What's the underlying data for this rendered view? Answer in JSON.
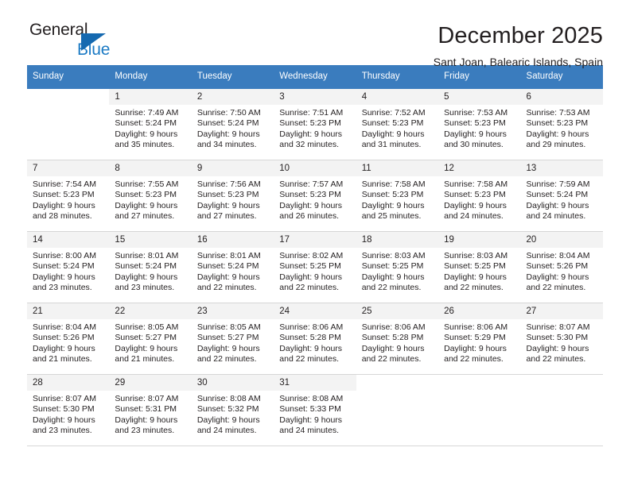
{
  "brand": {
    "line1": "General",
    "line2": "Blue",
    "triangle_color": "#1569b0",
    "blue_text_color": "#1b7ac4"
  },
  "header": {
    "title": "December 2025",
    "subtitle": "Sant Joan, Balearic Islands, Spain"
  },
  "theme": {
    "header_row_bg": "#3a7cbe",
    "header_row_text": "#ffffff",
    "daynum_bg": "#f3f3f3",
    "grid_line": "#d6d6d6"
  },
  "weekdays": [
    "Sunday",
    "Monday",
    "Tuesday",
    "Wednesday",
    "Thursday",
    "Friday",
    "Saturday"
  ],
  "weeks": [
    [
      {
        "day": "",
        "lines": []
      },
      {
        "day": "1",
        "lines": [
          "Sunrise: 7:49 AM",
          "Sunset: 5:24 PM",
          "Daylight: 9 hours",
          "and 35 minutes."
        ]
      },
      {
        "day": "2",
        "lines": [
          "Sunrise: 7:50 AM",
          "Sunset: 5:24 PM",
          "Daylight: 9 hours",
          "and 34 minutes."
        ]
      },
      {
        "day": "3",
        "lines": [
          "Sunrise: 7:51 AM",
          "Sunset: 5:23 PM",
          "Daylight: 9 hours",
          "and 32 minutes."
        ]
      },
      {
        "day": "4",
        "lines": [
          "Sunrise: 7:52 AM",
          "Sunset: 5:23 PM",
          "Daylight: 9 hours",
          "and 31 minutes."
        ]
      },
      {
        "day": "5",
        "lines": [
          "Sunrise: 7:53 AM",
          "Sunset: 5:23 PM",
          "Daylight: 9 hours",
          "and 30 minutes."
        ]
      },
      {
        "day": "6",
        "lines": [
          "Sunrise: 7:53 AM",
          "Sunset: 5:23 PM",
          "Daylight: 9 hours",
          "and 29 minutes."
        ]
      }
    ],
    [
      {
        "day": "7",
        "lines": [
          "Sunrise: 7:54 AM",
          "Sunset: 5:23 PM",
          "Daylight: 9 hours",
          "and 28 minutes."
        ]
      },
      {
        "day": "8",
        "lines": [
          "Sunrise: 7:55 AM",
          "Sunset: 5:23 PM",
          "Daylight: 9 hours",
          "and 27 minutes."
        ]
      },
      {
        "day": "9",
        "lines": [
          "Sunrise: 7:56 AM",
          "Sunset: 5:23 PM",
          "Daylight: 9 hours",
          "and 27 minutes."
        ]
      },
      {
        "day": "10",
        "lines": [
          "Sunrise: 7:57 AM",
          "Sunset: 5:23 PM",
          "Daylight: 9 hours",
          "and 26 minutes."
        ]
      },
      {
        "day": "11",
        "lines": [
          "Sunrise: 7:58 AM",
          "Sunset: 5:23 PM",
          "Daylight: 9 hours",
          "and 25 minutes."
        ]
      },
      {
        "day": "12",
        "lines": [
          "Sunrise: 7:58 AM",
          "Sunset: 5:23 PM",
          "Daylight: 9 hours",
          "and 24 minutes."
        ]
      },
      {
        "day": "13",
        "lines": [
          "Sunrise: 7:59 AM",
          "Sunset: 5:24 PM",
          "Daylight: 9 hours",
          "and 24 minutes."
        ]
      }
    ],
    [
      {
        "day": "14",
        "lines": [
          "Sunrise: 8:00 AM",
          "Sunset: 5:24 PM",
          "Daylight: 9 hours",
          "and 23 minutes."
        ]
      },
      {
        "day": "15",
        "lines": [
          "Sunrise: 8:01 AM",
          "Sunset: 5:24 PM",
          "Daylight: 9 hours",
          "and 23 minutes."
        ]
      },
      {
        "day": "16",
        "lines": [
          "Sunrise: 8:01 AM",
          "Sunset: 5:24 PM",
          "Daylight: 9 hours",
          "and 22 minutes."
        ]
      },
      {
        "day": "17",
        "lines": [
          "Sunrise: 8:02 AM",
          "Sunset: 5:25 PM",
          "Daylight: 9 hours",
          "and 22 minutes."
        ]
      },
      {
        "day": "18",
        "lines": [
          "Sunrise: 8:03 AM",
          "Sunset: 5:25 PM",
          "Daylight: 9 hours",
          "and 22 minutes."
        ]
      },
      {
        "day": "19",
        "lines": [
          "Sunrise: 8:03 AM",
          "Sunset: 5:25 PM",
          "Daylight: 9 hours",
          "and 22 minutes."
        ]
      },
      {
        "day": "20",
        "lines": [
          "Sunrise: 8:04 AM",
          "Sunset: 5:26 PM",
          "Daylight: 9 hours",
          "and 22 minutes."
        ]
      }
    ],
    [
      {
        "day": "21",
        "lines": [
          "Sunrise: 8:04 AM",
          "Sunset: 5:26 PM",
          "Daylight: 9 hours",
          "and 21 minutes."
        ]
      },
      {
        "day": "22",
        "lines": [
          "Sunrise: 8:05 AM",
          "Sunset: 5:27 PM",
          "Daylight: 9 hours",
          "and 21 minutes."
        ]
      },
      {
        "day": "23",
        "lines": [
          "Sunrise: 8:05 AM",
          "Sunset: 5:27 PM",
          "Daylight: 9 hours",
          "and 22 minutes."
        ]
      },
      {
        "day": "24",
        "lines": [
          "Sunrise: 8:06 AM",
          "Sunset: 5:28 PM",
          "Daylight: 9 hours",
          "and 22 minutes."
        ]
      },
      {
        "day": "25",
        "lines": [
          "Sunrise: 8:06 AM",
          "Sunset: 5:28 PM",
          "Daylight: 9 hours",
          "and 22 minutes."
        ]
      },
      {
        "day": "26",
        "lines": [
          "Sunrise: 8:06 AM",
          "Sunset: 5:29 PM",
          "Daylight: 9 hours",
          "and 22 minutes."
        ]
      },
      {
        "day": "27",
        "lines": [
          "Sunrise: 8:07 AM",
          "Sunset: 5:30 PM",
          "Daylight: 9 hours",
          "and 22 minutes."
        ]
      }
    ],
    [
      {
        "day": "28",
        "lines": [
          "Sunrise: 8:07 AM",
          "Sunset: 5:30 PM",
          "Daylight: 9 hours",
          "and 23 minutes."
        ]
      },
      {
        "day": "29",
        "lines": [
          "Sunrise: 8:07 AM",
          "Sunset: 5:31 PM",
          "Daylight: 9 hours",
          "and 23 minutes."
        ]
      },
      {
        "day": "30",
        "lines": [
          "Sunrise: 8:08 AM",
          "Sunset: 5:32 PM",
          "Daylight: 9 hours",
          "and 24 minutes."
        ]
      },
      {
        "day": "31",
        "lines": [
          "Sunrise: 8:08 AM",
          "Sunset: 5:33 PM",
          "Daylight: 9 hours",
          "and 24 minutes."
        ]
      },
      {
        "day": "",
        "lines": []
      },
      {
        "day": "",
        "lines": []
      },
      {
        "day": "",
        "lines": []
      }
    ]
  ]
}
